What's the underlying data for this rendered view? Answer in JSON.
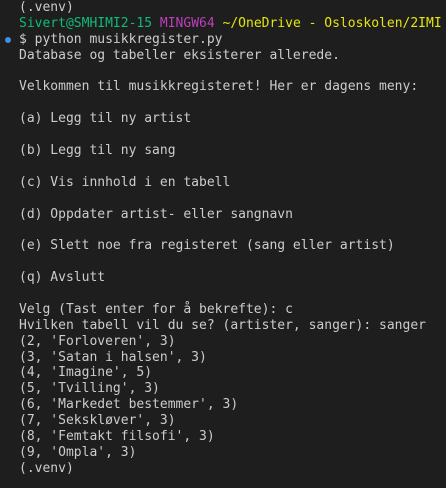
{
  "terminal": {
    "venv_top": "(.venv)",
    "prompt": {
      "user_host": "Sivert@SMHIMI2-15",
      "shell": "MINGW64",
      "path": "~/OneDrive - Osloskolen/2IMI"
    },
    "command": "$ python musikkregister.py",
    "output_db": "Database og tabeller eksisterer allerede.",
    "welcome": "Velkommen til musikkregisteret! Her er dagens meny:",
    "menu": [
      "(a) Legg til ny artist",
      "(b) Legg til ny sang",
      "(c) Vis innhold i en tabell",
      "(d) Oppdater artist- eller sangnavn",
      "(e) Slett noe fra registeret (sang eller artist)",
      "(q) Avslutt"
    ],
    "choice_prompt": "Velg (Tast enter for å bekrefte): c",
    "table_prompt": "Hvilken tabell vil du se? (artister, sanger): sanger",
    "rows": [
      "(2, 'Forloveren', 3)",
      "(3, 'Satan i halsen', 3)",
      "(4, 'Imagine', 5)",
      "(5, 'Tvilling', 3)",
      "(6, 'Markedet bestemmer', 3)",
      "(7, 'Sekskløver', 3)",
      "(8, 'Femtakt filsofi', 3)",
      "(9, 'Ompla', 3)"
    ],
    "venv_bottom": "(.venv)"
  }
}
